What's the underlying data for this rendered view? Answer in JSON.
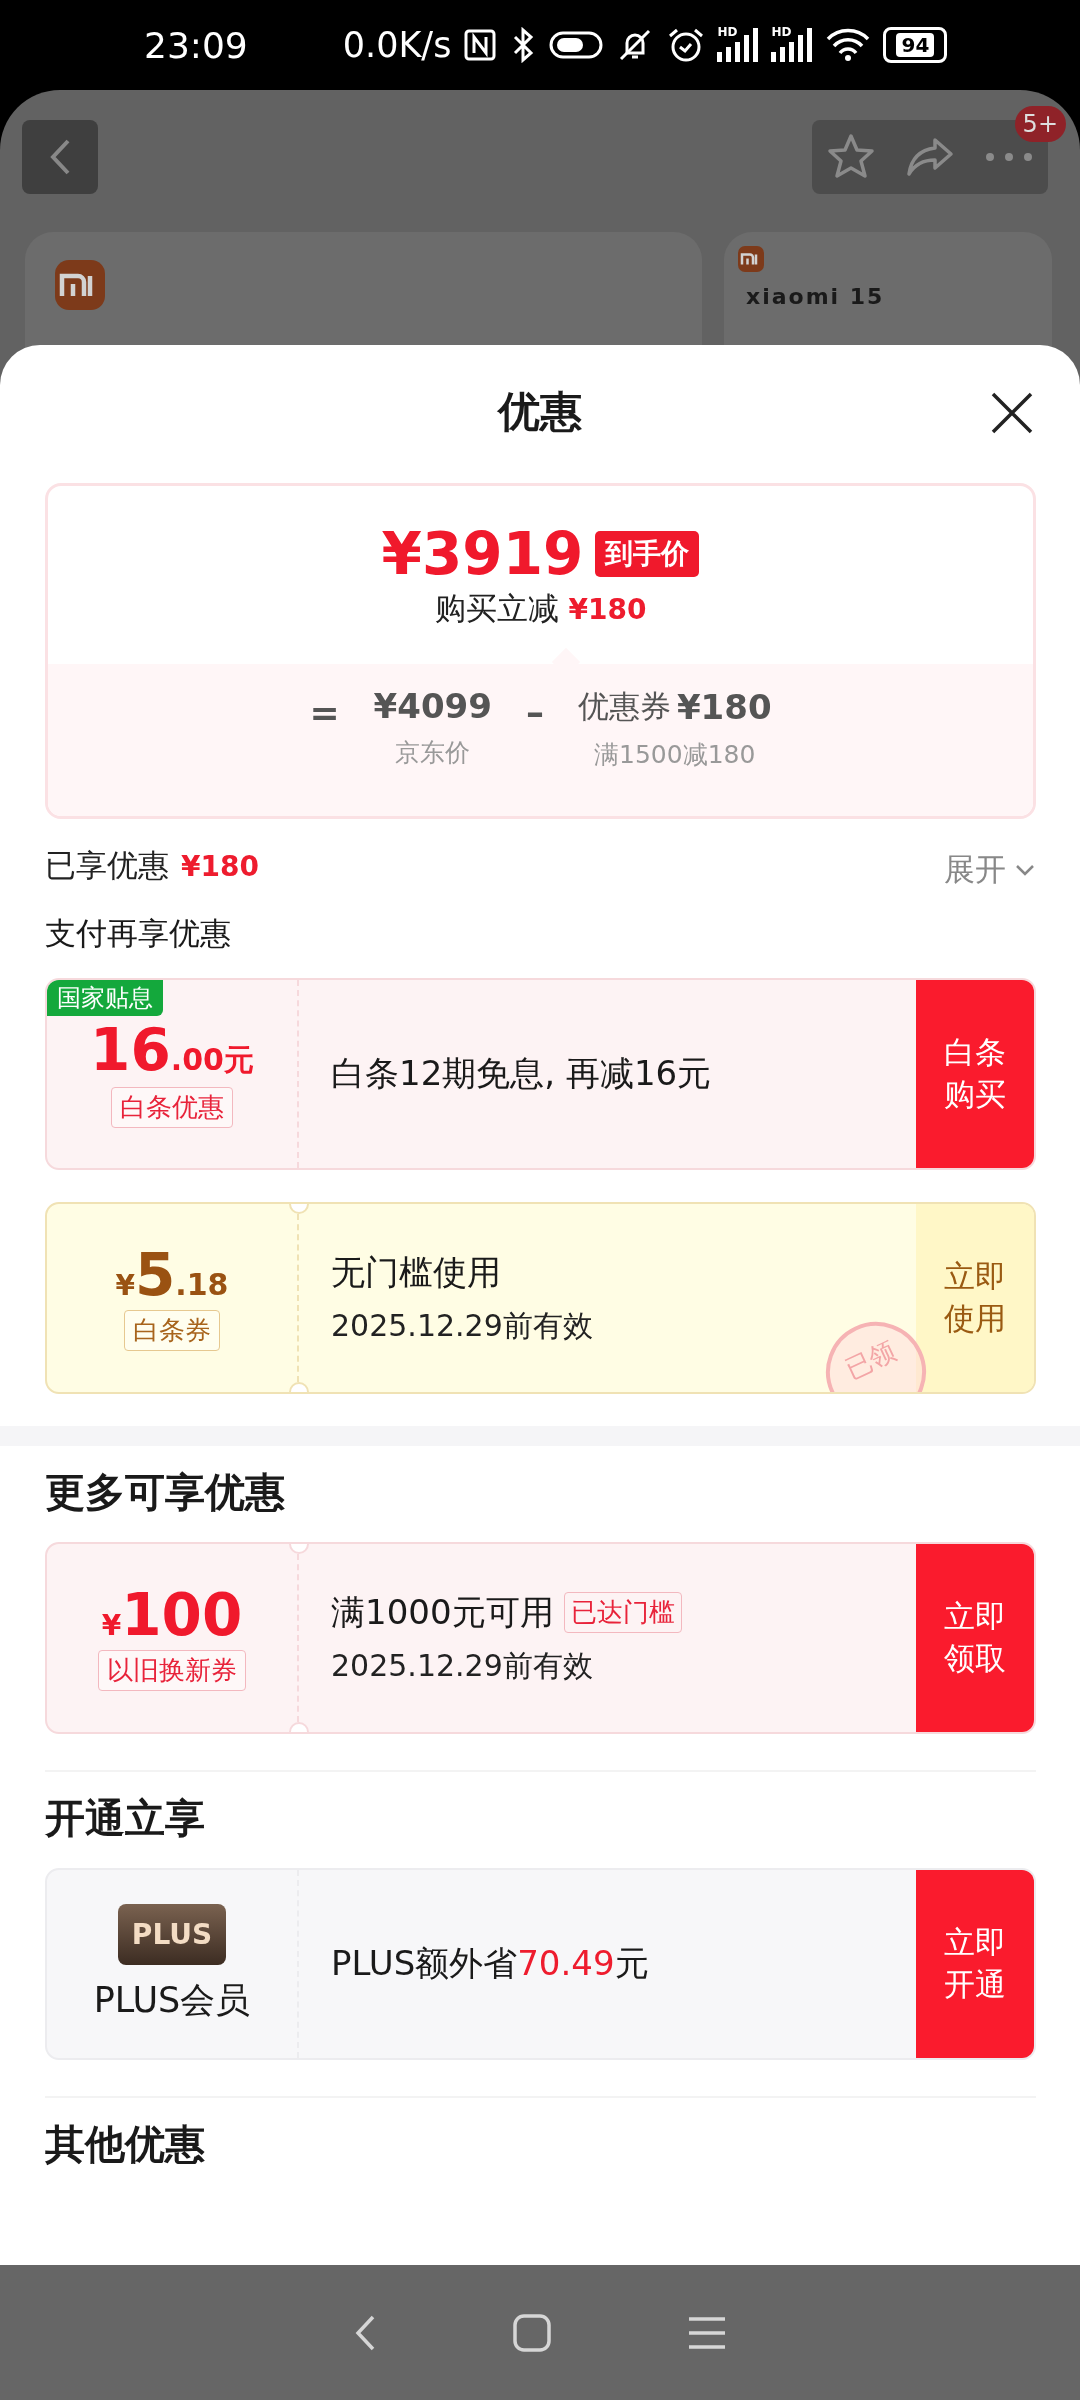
{
  "status_bar": {
    "time": "23:09",
    "net_speed": "0.0K/s",
    "sim_labels": [
      "HD",
      "HD"
    ],
    "battery": "94"
  },
  "background_page": {
    "more_badge": "5+",
    "product_title": "xiaomi 15"
  },
  "sheet": {
    "title": "优惠",
    "price_summary": {
      "final_price": "¥3919",
      "final_price_tag": "到手价",
      "instant_discount_label": "购买立减",
      "instant_discount_amount": "¥180",
      "equals": "=",
      "list_price": "¥4099",
      "list_price_label": "京东价",
      "minus": "–",
      "coupon_name": "优惠券",
      "coupon_amount": "¥180",
      "coupon_condition": "满1500减180"
    },
    "enjoyed": {
      "label": "已享优惠",
      "amount": "¥180",
      "toggle": "展开",
      "expanded": false
    },
    "sections": [
      {
        "title": "支付再享优惠",
        "offers": [
          {
            "kind": "subsidy",
            "color": "#fa1b2d",
            "corner_tag": "国家贴息",
            "value_main": "16",
            "value_decimal": ".00元",
            "tag": "白条优惠",
            "title": "白条12期免息, 再减16元",
            "action": "白条购买"
          },
          {
            "kind": "coupon",
            "color": "#fff7c7",
            "currency": "¥",
            "value_main": "5",
            "value_decimal": ".18",
            "tag": "白条券",
            "title": "无门槛使用",
            "subtitle": "2025.12.29前有效",
            "stamp": "已领",
            "action": "立即使用"
          }
        ]
      },
      {
        "title": "更多可享优惠",
        "offers": [
          {
            "kind": "coupon",
            "color": "#fa1b2d",
            "currency": "¥",
            "value_main": "100",
            "tag": "以旧换新券",
            "title": "满1000元可用",
            "title_badge": "已达门槛",
            "subtitle": "2025.12.29前有效",
            "action": "立即领取"
          }
        ]
      },
      {
        "title": "开通立享",
        "offers": [
          {
            "kind": "plus",
            "color": "#fa1b2d",
            "logo_text": "PLUS",
            "name": "PLUS会员",
            "desc_before": "PLUS额外省",
            "desc_highlight": "70.49",
            "desc_after": "元",
            "action": "立即开通"
          }
        ]
      },
      {
        "title": "其他优惠"
      }
    ]
  }
}
